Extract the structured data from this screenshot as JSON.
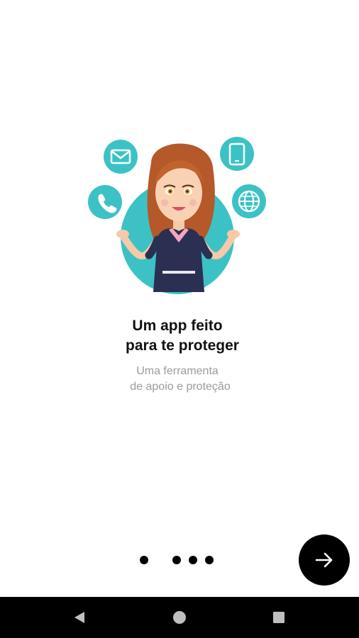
{
  "onboarding": {
    "title_line1": "Um app feito",
    "title_line2": "para te proteger",
    "subtitle_line1": "Uma ferramenta",
    "subtitle_line2": "de apoio e proteção",
    "page_count": 4,
    "current_page": 1
  },
  "colors": {
    "accent": "#3cc2c4",
    "text_title": "#111111",
    "text_subtitle": "#9b9b9b",
    "button_bg": "#000000"
  },
  "icons": {
    "next": "arrow-right-icon",
    "illustration": [
      "mail-icon",
      "phone-icon",
      "smartphone-icon",
      "globe-icon"
    ],
    "nav": [
      "back-triangle-icon",
      "home-circle-icon",
      "recents-square-icon"
    ]
  }
}
